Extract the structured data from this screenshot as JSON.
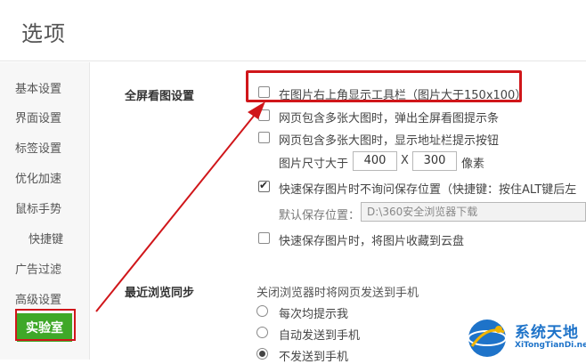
{
  "window": {
    "title": "选项"
  },
  "sidebar": {
    "items": [
      {
        "label": "基本设置"
      },
      {
        "label": "界面设置"
      },
      {
        "label": "标签设置"
      },
      {
        "label": "优化加速"
      },
      {
        "label": "鼠标手势"
      },
      {
        "label": "快捷键"
      },
      {
        "label": "广告过滤"
      },
      {
        "label": "高级设置"
      },
      {
        "label": "实验室",
        "active": true
      }
    ]
  },
  "fullscreen": {
    "title": "全屏看图设置",
    "opt_toolbar": {
      "label": "在图片右上角显示工具栏（图片大于150x100）",
      "checked": false
    },
    "opt_popup": {
      "label": "网页包含多张大图时，弹出全屏看图提示条",
      "checked": false
    },
    "opt_address": {
      "label": "网页包含多张大图时，显示地址栏提示按钮",
      "checked": false
    },
    "size": {
      "label": "图片尺寸大于",
      "width": "400",
      "separator": "X",
      "height": "300",
      "unit": "像素"
    },
    "opt_quicksave": {
      "label": "快速保存图片时不询问保存位置（快捷键：按住ALT键后左",
      "checked": true
    },
    "default_path": {
      "label": "默认保存位置：",
      "value": "D:\\360安全浏览器下载"
    },
    "opt_cloud": {
      "label": "快速保存图片时，将图片收藏到云盘",
      "checked": false
    }
  },
  "sync": {
    "title": "最近浏览同步",
    "desc": "关闭浏览器时将网页发送到手机",
    "options": [
      {
        "label": "每次均提示我",
        "selected": false
      },
      {
        "label": "自动发送到手机",
        "selected": false
      },
      {
        "label": "不发送到手机",
        "selected": true
      }
    ]
  },
  "annotation": {
    "highlight_color": "#d0161a"
  },
  "watermark": {
    "name": "系统天地",
    "url": "XiTongTianDi.net"
  }
}
